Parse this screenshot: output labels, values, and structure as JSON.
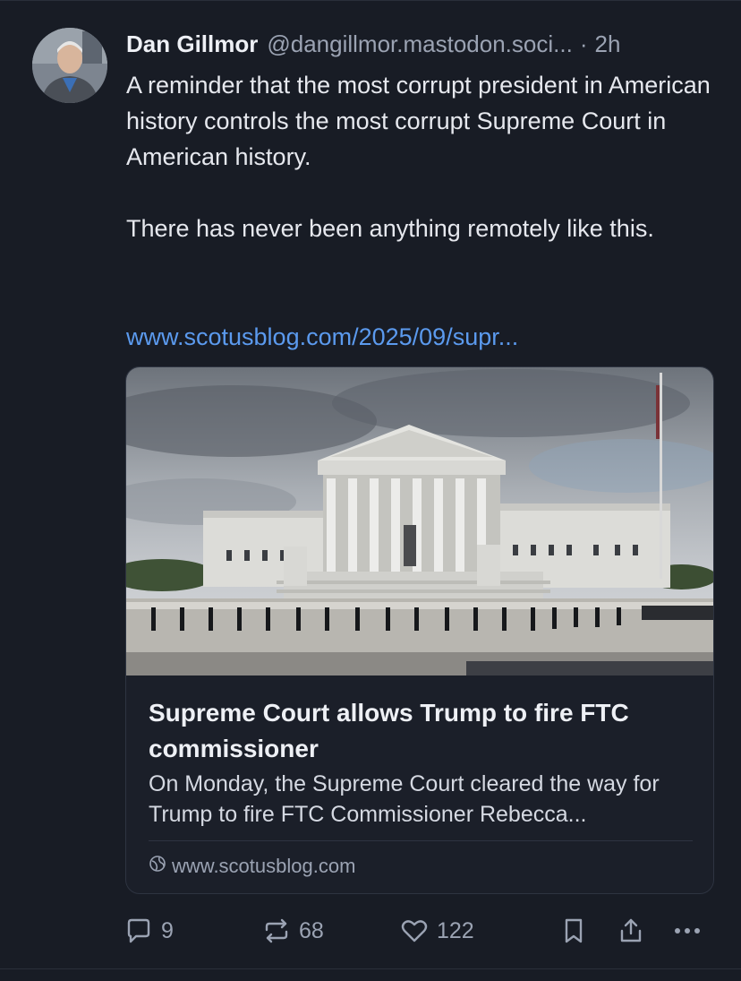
{
  "post": {
    "author_name": "Dan Gillmor",
    "handle": "@dangillmor.mastodon.soci...",
    "separator": "·",
    "time": "2h",
    "paragraphs": [
      "A reminder that the most corrupt president in American history controls the most corrupt Supreme Court in American history.",
      "There has never been anything remotely like this."
    ],
    "link_text": "www.scotusblog.com/2025/09/supr..."
  },
  "card": {
    "title": "Supreme Court allows Trump to fire FTC commissioner",
    "description": "On Monday, the Supreme Court cleared the way for Trump to fire FTC Commissioner Rebecca...",
    "source": "www.scotusblog.com",
    "source_icon": "globe-icon"
  },
  "actions": {
    "reply_count": "9",
    "repost_count": "68",
    "like_count": "122",
    "icons": [
      "reply-icon",
      "repost-icon",
      "like-icon",
      "bookmark-icon",
      "share-icon",
      "more-icon"
    ]
  },
  "colors": {
    "background": "#181c25",
    "link": "#5b9aee",
    "muted": "#9ba3b3"
  }
}
